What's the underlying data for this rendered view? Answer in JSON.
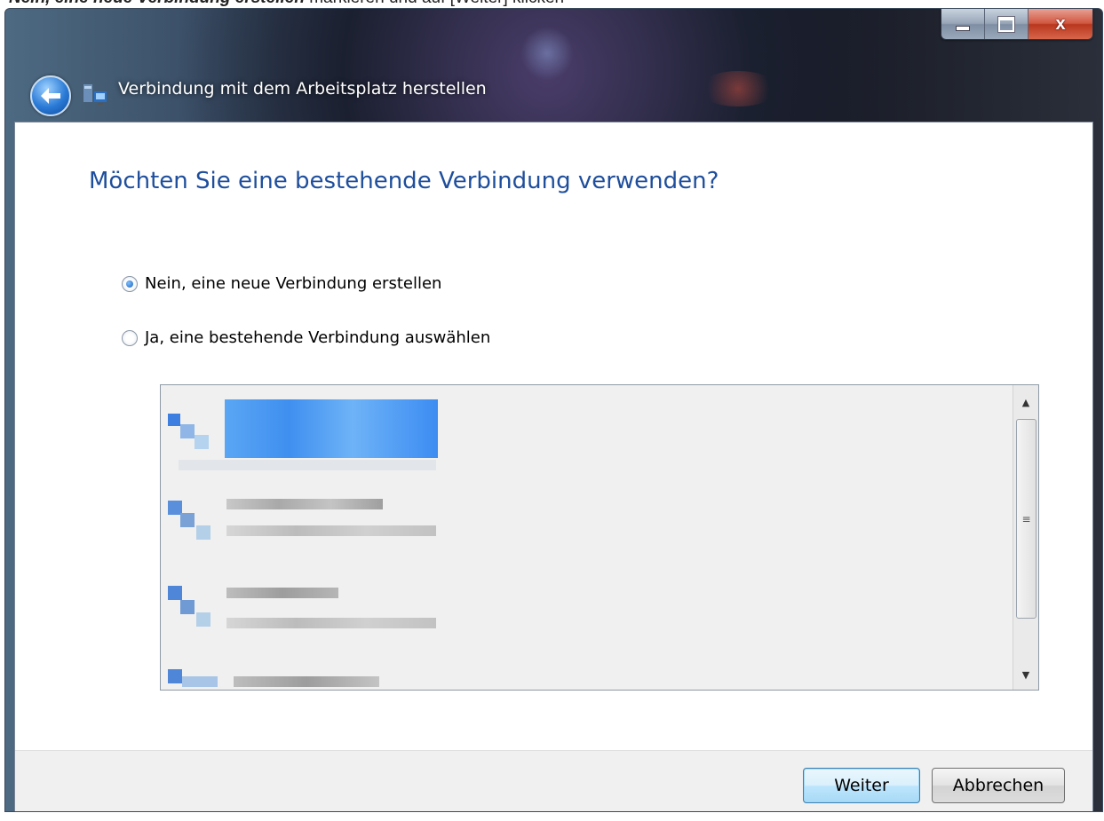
{
  "caption": {
    "bold": "Nein, eine neue Verbindung erstellen",
    "rest": " markieren und auf [Weiter] klicken"
  },
  "window": {
    "title": "Verbindung mit dem Arbeitsplatz herstellen",
    "controls": {
      "minimize": "minimize-icon",
      "maximize": "maximize-icon",
      "close_label": "x"
    }
  },
  "page": {
    "heading": "Möchten Sie eine bestehende Verbindung verwenden?",
    "options": [
      {
        "label": "Nein, eine neue Verbindung erstellen",
        "selected": true
      },
      {
        "label": "Ja, eine bestehende Verbindung auswählen",
        "selected": false
      }
    ]
  },
  "connections_list": {
    "items_visible": 4,
    "selected_index": 0,
    "note": ""
  },
  "buttons": {
    "next": "Weiter",
    "cancel": "Abbrechen"
  },
  "colors": {
    "heading": "#1e4e9c",
    "selection": "#4aa0f5",
    "accent": "#2a7ad6"
  }
}
